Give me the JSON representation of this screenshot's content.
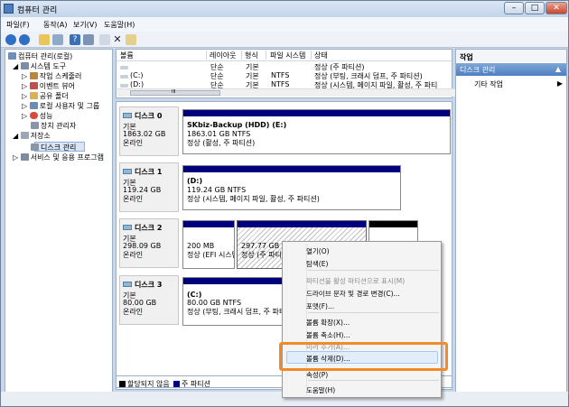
{
  "window": {
    "title": "컴퓨터 관리",
    "controls": [
      "–",
      "□",
      "✕"
    ]
  },
  "menu": [
    "파일(F)",
    "동작(A)",
    "보기(V)",
    "도움말(H)"
  ],
  "tree": {
    "root": "컴퓨터 관리(로컬)",
    "system_tools": "시스템 도구",
    "task_scheduler": "작업 스케줄러",
    "event_viewer": "이벤트 뷰어",
    "shared_folders": "공유 폴더",
    "local_users": "로컬 사용자 및 그룹",
    "performance": "성능",
    "device_manager": "장치 관리자",
    "storage": "저장소",
    "disk_management": "디스크 관리",
    "services": "서비스 및 응용 프로그램"
  },
  "volume": {
    "headers": [
      "볼륨",
      "레이아웃",
      "형식",
      "파일 시스템",
      "상태"
    ],
    "rows": [
      {
        "name": "",
        "layout": "단순",
        "type": "기본",
        "fs": "",
        "status": "정상 (주 파티션)"
      },
      {
        "name": "(C:)",
        "layout": "단순",
        "type": "기본",
        "fs": "NTFS",
        "status": "정상 (부팅, 크래시 덤프, 주 파티션)"
      },
      {
        "name": "(D:)",
        "layout": "단순",
        "type": "기본",
        "fs": "NTFS",
        "status": "정상 (시스템, 페이지 파일, 활성, 주 파티"
      }
    ],
    "hscroll_mark": "III"
  },
  "disks": [
    {
      "name": "디스크 0",
      "type": "기본",
      "size": "1863.02 GB",
      "state": "온라인"
    },
    {
      "name": "디스크 1",
      "type": "기본",
      "size": "119.24 GB",
      "state": "온라인"
    },
    {
      "name": "디스크 2",
      "type": "기본",
      "size": "298.09 GB",
      "state": "온라인"
    },
    {
      "name": "디스크 3",
      "type": "기본",
      "size": "80.00 GB",
      "state": "온라인"
    }
  ],
  "partitions": {
    "p0": {
      "name": "SKbiz-Backup (HDD)  (E:)",
      "size": "1863.01 GB NTFS",
      "status": "정상 (활성, 주 파티션)"
    },
    "p1": {
      "name": "(D:)",
      "size": "119.24 GB NTFS",
      "status": "정상 (시스템, 페이지 파일, 활성, 주 파티션)"
    },
    "p2a": {
      "size": "200 MB",
      "status": "정상 (EFI 시스템"
    },
    "p2b": {
      "size": "297.77 GB",
      "status": "정상 (주 파티션"
    },
    "p3": {
      "name": "(C:)",
      "size": "80.00 GB NTFS",
      "status": "정상 (부팅, 크래시 덤프, 주 파티션)"
    }
  },
  "legend": {
    "unallocated": "할당되지 않음",
    "primary": "주 파티션"
  },
  "actions": {
    "header": "작업",
    "selected": "디스크 관리",
    "more": "기타 작업",
    "arrow_up": "▲",
    "arrow_right": "▶"
  },
  "context_menu": {
    "open": "열기(O)",
    "explore": "탐색(E)",
    "mark_active": "파티션을 활성 파티션으로 표시(M)",
    "change_letter": "드라이브 문자 및 경로 변경(C)...",
    "format": "포맷(F)...",
    "extend": "볼륨 확장(X)...",
    "shrink": "볼륨 축소(H)...",
    "mirror": "미러 추가(A)...",
    "delete": "볼륨 삭제(D)...",
    "properties": "속성(P)",
    "help": "도움말(H)"
  },
  "colors": {
    "primary": "#00007e",
    "highlight": "#f28a28"
  }
}
